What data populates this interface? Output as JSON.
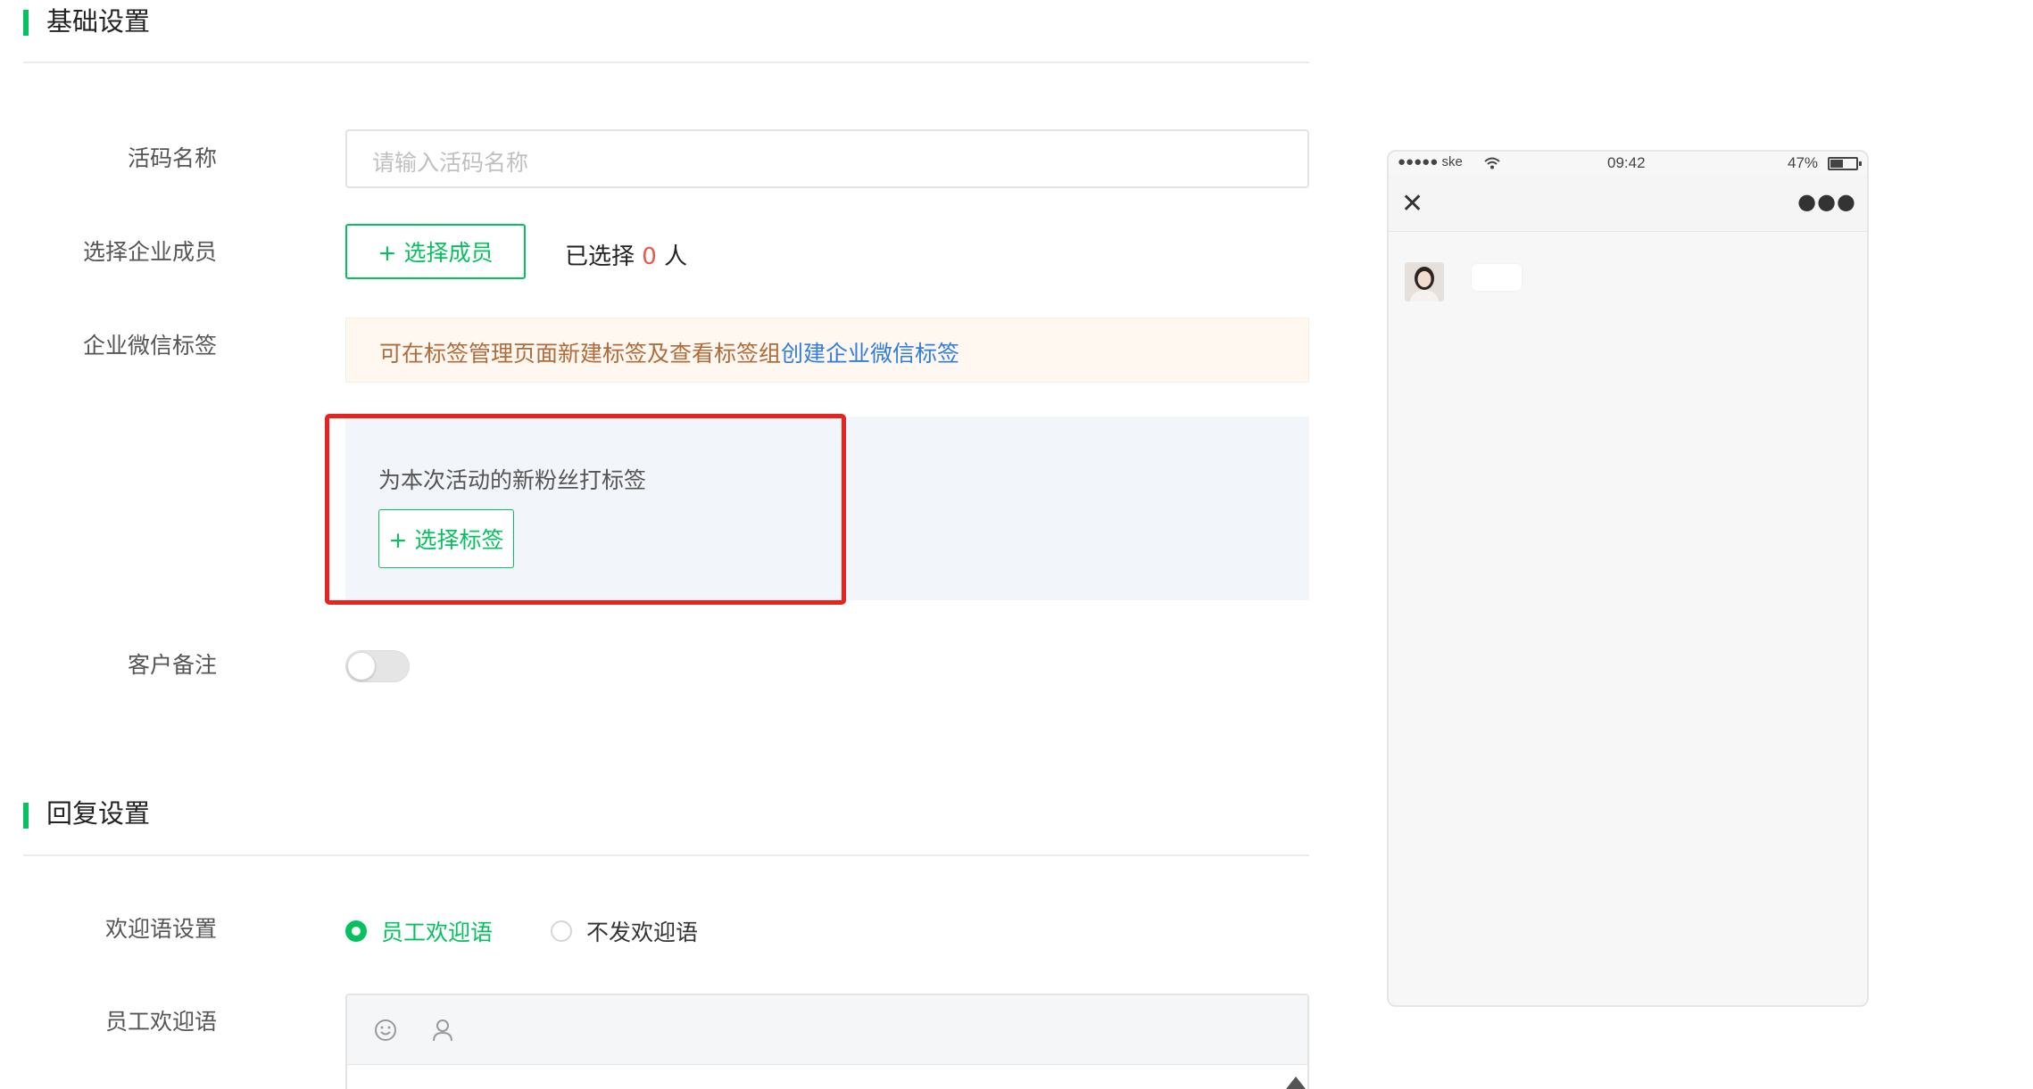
{
  "sections": {
    "basic": {
      "title": "基础设置"
    },
    "reply": {
      "title": "回复设置"
    }
  },
  "form": {
    "code_name": {
      "label": "活码名称",
      "placeholder": "请输入活码名称"
    },
    "members": {
      "label": "选择企业成员",
      "button": "+ 选择成员",
      "selected_prefix": "已选择 ",
      "selected_count": "0",
      "selected_suffix": " 人"
    },
    "wechat_tags": {
      "label": "企业微信标签",
      "notice_text": "可在标签管理页面新建标签及查看标签组",
      "notice_link": "创建企业微信标签",
      "panel_desc": "为本次活动的新粉丝打标签",
      "panel_button": "+ 选择标签"
    },
    "customer_note": {
      "label": "客户备注",
      "enabled": false
    },
    "welcome": {
      "label": "欢迎语设置",
      "options": [
        "员工欢迎语",
        "不发欢迎语"
      ],
      "selected": "员工欢迎语"
    },
    "staff_welcome": {
      "label": "员工欢迎语",
      "icons": [
        "emoji-icon",
        "user-icon"
      ]
    }
  },
  "phone": {
    "carrier": "●●●●● ske",
    "time": "09:42",
    "battery": "47%",
    "icons": [
      "close-icon",
      "more-icon",
      "wifi-icon",
      "battery-icon"
    ]
  },
  "colors": {
    "accent": "#07c160",
    "highlight_border": "#e8221c",
    "link": "#2f7de1",
    "notice_text": "#b06b3a",
    "count": "#f0554a"
  }
}
